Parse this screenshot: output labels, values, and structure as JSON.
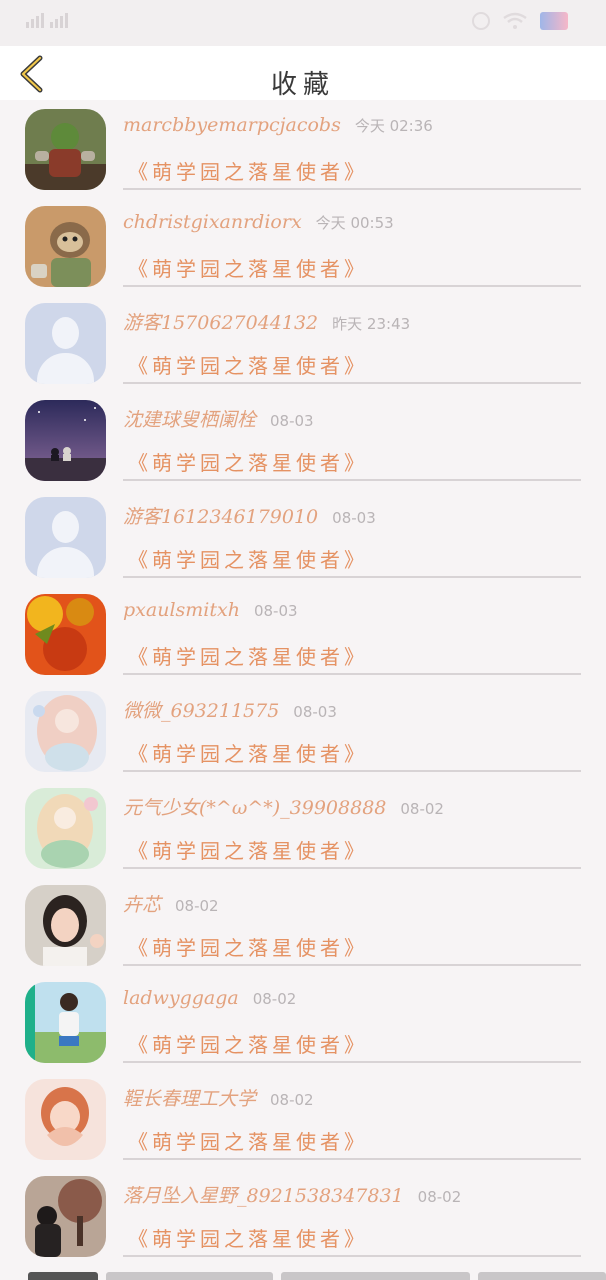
{
  "header": {
    "title": "收藏"
  },
  "items": [
    {
      "user": "marcbbyemarpcjacobs",
      "time": "今天 02:36",
      "book": "《萌学园之落星使者》",
      "avatar": "orc-warrior"
    },
    {
      "user": "chdristgixanrdiorx",
      "time": "今天 00:53",
      "book": "《萌学园之落星使者》",
      "avatar": "sloth-cartoon"
    },
    {
      "user": "游客1570627044132",
      "time": "昨天 23:43",
      "book": "《萌学园之落星使者》",
      "avatar": "default"
    },
    {
      "user": "沈建球叟栖阑栓",
      "time": "08-03",
      "book": "《萌学园之落星使者》",
      "avatar": "night-sky"
    },
    {
      "user": "游客1612346179010",
      "time": "08-03",
      "book": "《萌学园之落星使者》",
      "avatar": "default"
    },
    {
      "user": "pxaulsmitxh",
      "time": "08-03",
      "book": "《萌学园之落星使者》",
      "avatar": "autumn-leaves"
    },
    {
      "user": "微微_693211575",
      "time": "08-03",
      "book": "《萌学园之落星使者》",
      "avatar": "anime-girl-pink"
    },
    {
      "user": "元气少女(*^ω^*)_39908888",
      "time": "08-02",
      "book": "《萌学园之落星使者》",
      "avatar": "anime-girl-green"
    },
    {
      "user": "卉芯",
      "time": "08-02",
      "book": "《萌学园之落星使者》",
      "avatar": "girl-photo"
    },
    {
      "user": "ladwyggaga",
      "time": "08-02",
      "book": "《萌学园之落星使者》",
      "avatar": "girl-outdoor"
    },
    {
      "user": "鞓长春理工大学",
      "time": "08-02",
      "book": "《萌学园之落星使者》",
      "avatar": "heart-hands"
    },
    {
      "user": "落月坠入星野_8921538347831",
      "time": "08-02",
      "book": "《萌学园之落星使者》",
      "avatar": "tree-photo"
    }
  ]
}
